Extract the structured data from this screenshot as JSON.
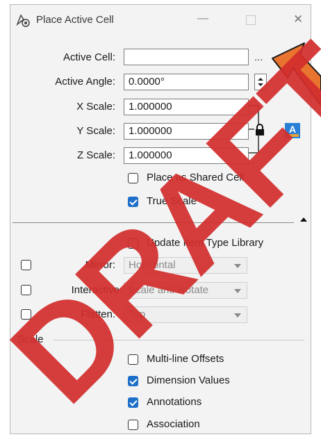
{
  "window": {
    "title": "Place Active Cell",
    "minimize_glyph": "—",
    "close_glyph": "✕"
  },
  "fields": {
    "active_cell_label": "Active Cell:",
    "active_cell_value": "",
    "browse_label": "...",
    "active_angle_label": "Active Angle:",
    "active_angle_value": "0.0000°",
    "x_scale_label": "X Scale:",
    "x_scale_value": "1.000000",
    "y_scale_label": "Y Scale:",
    "y_scale_value": "1.000000",
    "z_scale_label": "Z Scale:",
    "z_scale_value": "1.000000"
  },
  "options": {
    "place_shared_cell": {
      "label": "Place as Shared Cell",
      "checked": false
    },
    "true_scale": {
      "label": "True Scale",
      "checked": true
    },
    "update_item_type_library": {
      "label": "Update Item Type Library",
      "checked": false
    }
  },
  "transforms": {
    "mirror": {
      "label": "Mirror:",
      "value": "Horizontal",
      "checked": false
    },
    "interactive": {
      "label": "Interactive:",
      "value": "Scale and Rotate",
      "checked": false
    },
    "flatten": {
      "label": "Flatten:",
      "value": "Top",
      "checked": false
    }
  },
  "scale_section": {
    "title": "Scale",
    "items": [
      {
        "label": "Multi-line Offsets",
        "checked": false
      },
      {
        "label": "Dimension Values",
        "checked": true
      },
      {
        "label": "Annotations",
        "checked": true
      },
      {
        "label": "Association",
        "checked": false
      }
    ]
  },
  "watermark": "DRAFT",
  "colors": {
    "accent": "#1e6fc9",
    "arrow": "#e8742f",
    "watermark": "#d22d2d"
  },
  "icons": {
    "app": "cell-placement-icon",
    "lock": "lock-icon",
    "text_style": "text-style-icon",
    "collapse": "triangle-up-icon"
  }
}
